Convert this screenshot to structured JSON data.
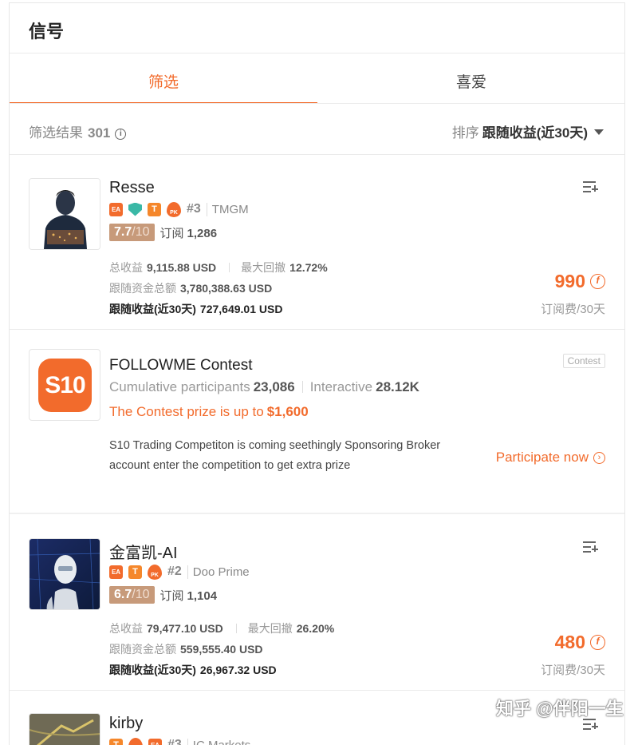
{
  "header": {
    "title": "信号"
  },
  "tabs": [
    {
      "label": "筛选",
      "active": true
    },
    {
      "label": "喜爱",
      "active": false
    }
  ],
  "filter": {
    "label": "筛选结果",
    "count": "301",
    "info_icon": "info-icon"
  },
  "sort": {
    "label": "排序",
    "value": "跟随收益(近30天)"
  },
  "signals": [
    {
      "name": "Resse",
      "badges": [
        "EA",
        "verified-shield",
        "T",
        "PK"
      ],
      "rank": "#3",
      "broker": "TMGM",
      "score": "7.7",
      "score_max": "/10",
      "subs_label": "订阅",
      "subs_count": "1,286",
      "total_profit_label": "总收益",
      "total_profit": "9,115.88 USD",
      "max_drawdown_label": "最大回撤",
      "max_drawdown": "12.72%",
      "follow_funds_label": "跟随资金总额",
      "follow_funds": "3,780,388.63 USD",
      "follow_profit_label": "跟随收益(近30天)",
      "follow_profit": "727,649.01 USD",
      "price": "990",
      "price_unit": "订阅费/30天"
    },
    {
      "name": "金富凯-AI",
      "badges": [
        "EA",
        "T",
        "PK"
      ],
      "rank": "#2",
      "broker": "Doo Prime",
      "score": "6.7",
      "score_max": "/10",
      "subs_label": "订阅",
      "subs_count": "1,104",
      "total_profit_label": "总收益",
      "total_profit": "79,477.10 USD",
      "max_drawdown_label": "最大回撤",
      "max_drawdown": "26.20%",
      "follow_funds_label": "跟随资金总额",
      "follow_funds": "559,555.40 USD",
      "follow_profit_label": "跟随收益(近30天)",
      "follow_profit": "26,967.32 USD",
      "price": "480",
      "price_unit": "订阅费/30天"
    },
    {
      "name": "kirby",
      "rank": "#3",
      "broker": "IC Markets"
    }
  ],
  "contest": {
    "logo_text": "S10",
    "title": "FOLLOWME Contest",
    "tag": "Contest",
    "participants_label": "Cumulative participants",
    "participants": "23,086",
    "interactive_label": "Interactive",
    "interactive": "28.12K",
    "prize_label": "The Contest prize is up to",
    "prize": "$1,600",
    "description": "S10 Trading Competiton is coming seethingly Sponsoring Broker account enter the competition to get extra prize",
    "cta": "Participate now"
  },
  "watermark": "知乎 @伴阳一生",
  "colors": {
    "accent": "#f26b2c",
    "score_bg": "#c79a7a",
    "verified": "#3ab8a6"
  }
}
